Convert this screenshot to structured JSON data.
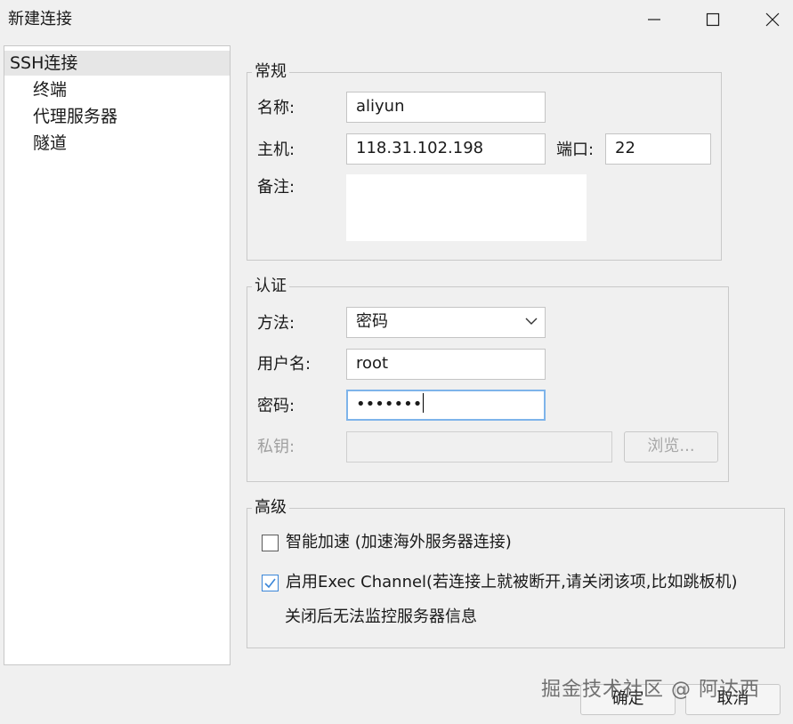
{
  "window": {
    "title": "新建连接",
    "controls": {
      "minimize": "minimize-icon",
      "maximize": "maximize-icon",
      "close": "close-icon"
    }
  },
  "sidebar": {
    "root": "SSH连接",
    "items": [
      "终端",
      "代理服务器",
      "隧道"
    ]
  },
  "general": {
    "title": "常规",
    "name_label": "名称:",
    "name_value": "aliyun",
    "host_label": "主机:",
    "host_value": "118.31.102.198",
    "port_label": "端口:",
    "port_value": "22",
    "note_label": "备注:",
    "note_value": ""
  },
  "auth": {
    "title": "认证",
    "method_label": "方法:",
    "method_value": "密码",
    "user_label": "用户名:",
    "user_value": "root",
    "password_label": "密码:",
    "password_value": "•••••••",
    "key_label": "私钥:",
    "key_value": "",
    "browse_label": "浏览..."
  },
  "advanced": {
    "title": "高级",
    "smart_accel_label": "智能加速 (加速海外服务器连接)",
    "smart_accel_checked": false,
    "exec_channel_label": "启用Exec Channel(若连接上就被断开,请关闭该项,比如跳板机)",
    "exec_channel_checked": true,
    "exec_channel_note": "关闭后无法监控服务器信息"
  },
  "footer": {
    "ok_label": "确定",
    "cancel_label": "取消"
  },
  "watermark": "掘金技术社区 @ 阿达西",
  "colors": {
    "focus_border": "#7eb4ea",
    "check_accent": "#3b86d8",
    "selected_row": "#e6e6e6"
  }
}
